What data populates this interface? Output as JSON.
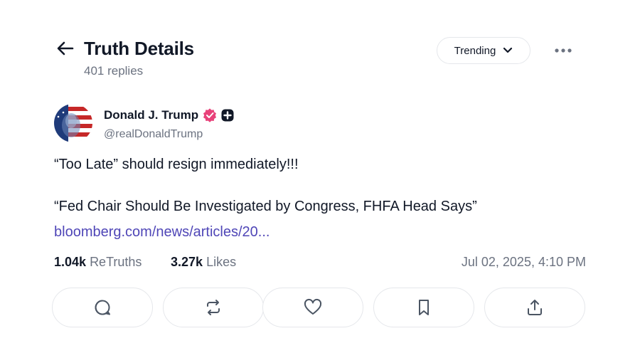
{
  "header": {
    "title": "Truth Details",
    "subtitle": "401 replies",
    "sort_label": "Trending"
  },
  "post": {
    "author_name": "Donald J. Trump",
    "handle": "@realDonaldTrump",
    "line1": "“Too Late” should resign immediately!!!",
    "line2": "“Fed Chair Should Be Investigated by Congress, FHFA Head Says”",
    "link": "bloomberg.com/news/articles/20...",
    "retruths_count": "1.04k",
    "retruths_label": "ReTruths",
    "likes_count": "3.27k",
    "likes_label": "Likes",
    "timestamp": "Jul 02, 2025, 4:10 PM"
  },
  "icons": {
    "back": "arrow-left-icon",
    "sort": "chevron-down-icon",
    "more": "more-horizontal-icon",
    "verified": "verified-badge-icon",
    "plus": "plus-badge-icon",
    "reply": "reply-icon",
    "retruth": "retruth-icon",
    "like": "heart-icon",
    "bookmark": "bookmark-icon",
    "share": "share-icon"
  },
  "colors": {
    "text": "#111827",
    "muted": "#6b7280",
    "link": "#4f46b7",
    "verified": "#e8427a",
    "border": "#e5e7eb"
  }
}
